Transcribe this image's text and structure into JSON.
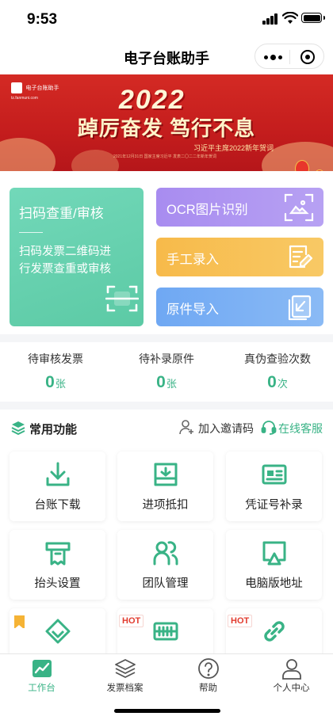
{
  "status_bar": {
    "time": "9:53"
  },
  "nav": {
    "title": "电子台账助手"
  },
  "banner": {
    "logo_text": "电子台账助手",
    "logo_url": "tz.fanmuni.com",
    "year": "2022",
    "slogan": "踔厉奋发  笃行不息",
    "subtitle": "习近平主席2022新年贺词",
    "date_line": "2021年12月31日 国家主席习近平 发表二〇二二年新年贺词"
  },
  "cards": {
    "scan": {
      "title": "扫码查重/审核",
      "desc": "扫码发票二维码进行发票查重或审核"
    },
    "ocr": {
      "label": "OCR图片识别"
    },
    "manual": {
      "label": "手工录入"
    },
    "import": {
      "label": "原件导入"
    }
  },
  "stats": [
    {
      "label": "待审核发票",
      "value": "0",
      "unit": "张"
    },
    {
      "label": "待补录原件",
      "value": "0",
      "unit": "张"
    },
    {
      "label": "真伪查验次数",
      "value": "0",
      "unit": "次"
    }
  ],
  "functions": {
    "title": "常用功能",
    "invite": "加入邀请码",
    "support": "在线客服",
    "tiles": [
      {
        "label": "台账下载",
        "icon": "download-icon"
      },
      {
        "label": "进项抵扣",
        "icon": "inbox-download-icon"
      },
      {
        "label": "凭证号补录",
        "icon": "id-card-icon"
      },
      {
        "label": "抬头设置",
        "icon": "receipt-printer-icon"
      },
      {
        "label": "团队管理",
        "icon": "team-icon"
      },
      {
        "label": "电脑版地址",
        "icon": "monitor-icon"
      },
      {
        "label": "",
        "icon": "diamond-icon",
        "badge": "bookmark"
      },
      {
        "label": "",
        "icon": "server-icon",
        "badge": "HOT"
      },
      {
        "label": "",
        "icon": "link-icon",
        "badge": "HOT"
      }
    ]
  },
  "tabbar": [
    {
      "label": "工作台",
      "icon": "chart-icon",
      "active": true
    },
    {
      "label": "发票档案",
      "icon": "layers-icon",
      "active": false
    },
    {
      "label": "帮助",
      "icon": "question-icon",
      "active": false
    },
    {
      "label": "个人中心",
      "icon": "user-icon",
      "active": false
    }
  ],
  "colors": {
    "accent": "#39b386",
    "scan_card": "#5ccaa5",
    "ocr_card": "#a88cf0",
    "manual_card": "#f7ba4a",
    "import_card": "#6fa8f3",
    "banner": "#c41d1d",
    "hot": "#e23b2e"
  }
}
